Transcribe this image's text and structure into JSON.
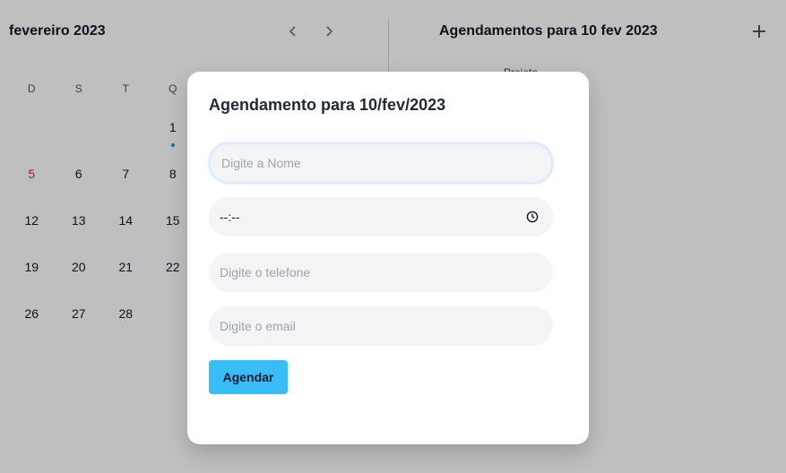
{
  "calendar": {
    "month_title": "fevereiro 2023",
    "weekdays": [
      "D",
      "S",
      "T",
      "Q"
    ],
    "weeks": [
      [
        "",
        "",
        "",
        "1"
      ],
      [
        "5",
        "6",
        "7",
        "8"
      ],
      [
        "12",
        "13",
        "14",
        "15"
      ],
      [
        "19",
        "20",
        "21",
        "22"
      ],
      [
        "26",
        "27",
        "28",
        ""
      ]
    ],
    "highlight_color": "#dc2626",
    "event_dot_color": "#0ea5e9"
  },
  "schedule": {
    "title": "Agendamentos para 10 fev 2023",
    "hint": "Projeto"
  },
  "modal": {
    "title": "Agendamento para 10/fev/2023",
    "name_placeholder": "Digite a Nome",
    "time_value": "--:--",
    "phone_placeholder": "Digite o telefone",
    "email_placeholder": "Digite o email",
    "submit_label": "Agendar",
    "accent_color": "#38bdf8"
  }
}
